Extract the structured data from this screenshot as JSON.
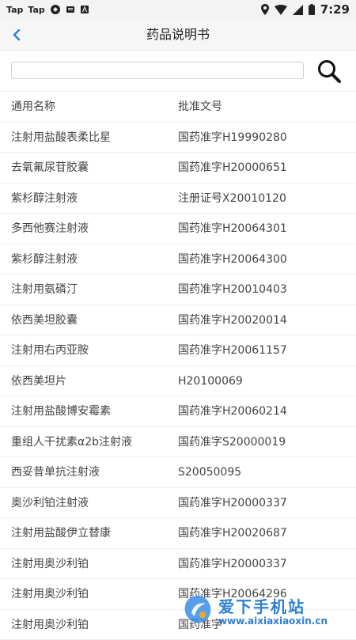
{
  "status_bar": {
    "tap_1": "Tap",
    "tap_2": "Tap",
    "time": "7:29"
  },
  "header": {
    "title": "药品说明书"
  },
  "search": {
    "placeholder": ""
  },
  "table": {
    "columns": [
      "通用名称",
      "批准文号"
    ],
    "rows": [
      {
        "name": "注射用盐酸表柔比星",
        "approval": "国药准字H19990280"
      },
      {
        "name": "去氧氟尿苷胶囊",
        "approval": "国药准字H20000651"
      },
      {
        "name": "紫杉醇注射液",
        "approval": "注册证号X20010120"
      },
      {
        "name": "多西他赛注射液",
        "approval": "国药准字H20064301"
      },
      {
        "name": "紫杉醇注射液",
        "approval": "国药准字H20064300"
      },
      {
        "name": "注射用氨磷汀",
        "approval": "国药准字H20010403"
      },
      {
        "name": "依西美坦胶囊",
        "approval": "国药准字H20020014"
      },
      {
        "name": "注射用右丙亚胺",
        "approval": "国药准字H20061157"
      },
      {
        "name": "依西美坦片",
        "approval": "H20100069"
      },
      {
        "name": "注射用盐酸博安霉素",
        "approval": "国药准字H20060214"
      },
      {
        "name": "重组人干扰素α2b注射液",
        "approval": "国药准字S20000019"
      },
      {
        "name": "西妥昔单抗注射液",
        "approval": "S20050095"
      },
      {
        "name": "奥沙利铂注射液",
        "approval": "国药准字H20000337"
      },
      {
        "name": "注射用盐酸伊立替康",
        "approval": "国药准字H20020687"
      },
      {
        "name": "注射用奥沙利铂",
        "approval": "国药准字H20000337"
      },
      {
        "name": "注射用奥沙利铂",
        "approval": "国药准字H20064296"
      },
      {
        "name": "注射用奥沙利铂",
        "approval": "国药准字"
      }
    ]
  },
  "watermark": {
    "main": "爱下手机站",
    "url": "www.aixiaxiaoxin.cn"
  },
  "colors": {
    "accent": "#2f7fd6",
    "back_arrow": "#2f7fd6"
  }
}
